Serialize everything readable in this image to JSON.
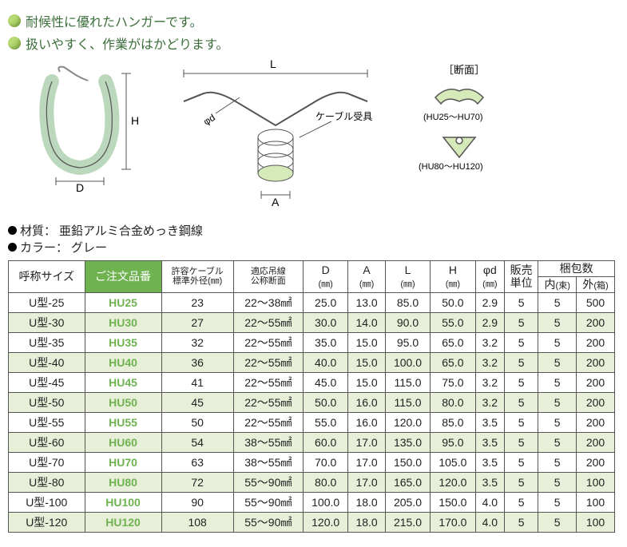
{
  "bullets": [
    "耐候性に優れたハンガーです。",
    "扱いやすく、作業がはかどります。"
  ],
  "diagram": {
    "labels": {
      "L": "L",
      "H": "H",
      "D": "D",
      "A": "A",
      "phid": "φd",
      "cable": "ケーブル受具",
      "section": "［断面］",
      "range1": "(HU25～HU70)",
      "range2": "(HU80～HU120)"
    }
  },
  "material": {
    "label": "材質：",
    "value": "亜鉛アルミ合金めっき鋼線"
  },
  "color": {
    "label": "カラー：",
    "value": "グレー"
  },
  "headers": {
    "size": "呼称サイズ",
    "part": "ご注文品番",
    "cablecap": "許容ケーブル",
    "cablecap2": "標準外径(㎜)",
    "wire": "適応吊線",
    "wire2": "公称断面",
    "D": "D",
    "A": "A",
    "L": "L",
    "H": "H",
    "phid": "φd",
    "mm": "(㎜)",
    "unit": "販売",
    "unit2": "単位",
    "pack": "梱包数",
    "inner": "内",
    "innerU": "(束)",
    "outer": "外",
    "outerU": "(箱)"
  },
  "rows": [
    {
      "size": "U型-25",
      "part": "HU25",
      "cap": "23",
      "wire": "22～38㎟",
      "D": "25.0",
      "A": "13.0",
      "L": "85.0",
      "H": "50.0",
      "phid": "2.9",
      "unit": "5",
      "inner": "5",
      "outer": "500"
    },
    {
      "size": "U型-30",
      "part": "HU30",
      "cap": "27",
      "wire": "22～55㎟",
      "D": "30.0",
      "A": "14.0",
      "L": "90.0",
      "H": "55.0",
      "phid": "2.9",
      "unit": "5",
      "inner": "5",
      "outer": "200"
    },
    {
      "size": "U型-35",
      "part": "HU35",
      "cap": "32",
      "wire": "22～55㎟",
      "D": "35.0",
      "A": "15.0",
      "L": "95.0",
      "H": "65.0",
      "phid": "3.2",
      "unit": "5",
      "inner": "5",
      "outer": "200"
    },
    {
      "size": "U型-40",
      "part": "HU40",
      "cap": "36",
      "wire": "22～55㎟",
      "D": "40.0",
      "A": "15.0",
      "L": "100.0",
      "H": "65.0",
      "phid": "3.2",
      "unit": "5",
      "inner": "5",
      "outer": "200"
    },
    {
      "size": "U型-45",
      "part": "HU45",
      "cap": "41",
      "wire": "22～55㎟",
      "D": "45.0",
      "A": "15.0",
      "L": "115.0",
      "H": "75.0",
      "phid": "3.2",
      "unit": "5",
      "inner": "5",
      "outer": "200"
    },
    {
      "size": "U型-50",
      "part": "HU50",
      "cap": "45",
      "wire": "22～55㎟",
      "D": "50.0",
      "A": "16.0",
      "L": "115.0",
      "H": "80.0",
      "phid": "3.2",
      "unit": "5",
      "inner": "5",
      "outer": "200"
    },
    {
      "size": "U型-55",
      "part": "HU55",
      "cap": "50",
      "wire": "22～55㎟",
      "D": "55.0",
      "A": "16.0",
      "L": "120.0",
      "H": "85.0",
      "phid": "3.5",
      "unit": "5",
      "inner": "5",
      "outer": "200"
    },
    {
      "size": "U型-60",
      "part": "HU60",
      "cap": "54",
      "wire": "38～55㎟",
      "D": "60.0",
      "A": "17.0",
      "L": "135.0",
      "H": "95.0",
      "phid": "3.5",
      "unit": "5",
      "inner": "5",
      "outer": "200"
    },
    {
      "size": "U型-70",
      "part": "HU70",
      "cap": "63",
      "wire": "38～55㎟",
      "D": "70.0",
      "A": "17.0",
      "L": "150.0",
      "H": "105.0",
      "phid": "3.5",
      "unit": "5",
      "inner": "5",
      "outer": "200"
    },
    {
      "size": "U型-80",
      "part": "HU80",
      "cap": "72",
      "wire": "55～90㎟",
      "D": "80.0",
      "A": "17.0",
      "L": "165.0",
      "H": "120.0",
      "phid": "3.5",
      "unit": "5",
      "inner": "5",
      "outer": "100"
    },
    {
      "size": "U型-100",
      "part": "HU100",
      "cap": "90",
      "wire": "55～90㎟",
      "D": "100.0",
      "A": "18.0",
      "L": "205.0",
      "H": "150.0",
      "phid": "4.0",
      "unit": "5",
      "inner": "5",
      "outer": "100"
    },
    {
      "size": "U型-120",
      "part": "HU120",
      "cap": "108",
      "wire": "55～90㎟",
      "D": "120.0",
      "A": "18.0",
      "L": "215.0",
      "H": "170.0",
      "phid": "4.0",
      "unit": "5",
      "inner": "5",
      "outer": "100"
    }
  ]
}
